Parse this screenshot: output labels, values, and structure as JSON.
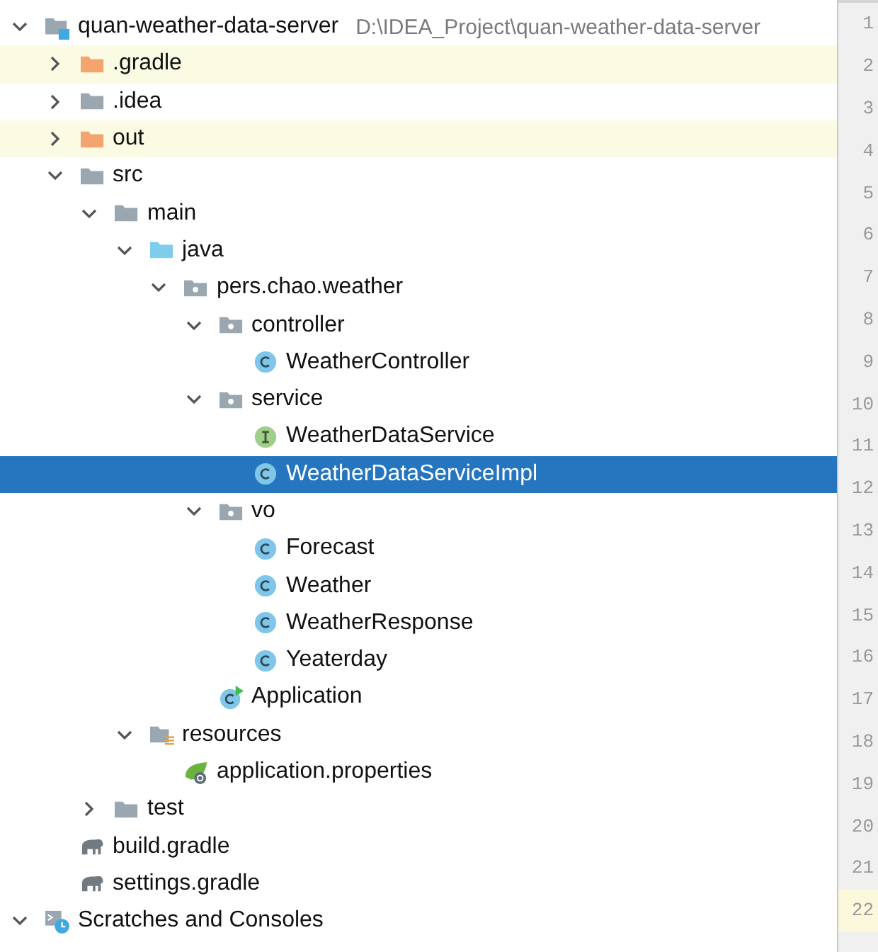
{
  "project_tree": [
    {
      "label": "quan-weather-data-server",
      "path": "D:\\IDEA_Project\\quan-weather-data-server",
      "kind": "module",
      "expanded": true,
      "selected": false,
      "children": [
        {
          "label": ".gradle",
          "kind": "folder",
          "excluded": true,
          "expanded": false,
          "selected": false
        },
        {
          "label": ".idea",
          "kind": "folder",
          "excluded": false,
          "expanded": false,
          "selected": false
        },
        {
          "label": "out",
          "kind": "folder",
          "excluded": true,
          "expanded": false,
          "selected": false
        },
        {
          "label": "src",
          "kind": "folder",
          "excluded": false,
          "expanded": true,
          "selected": false,
          "children": [
            {
              "label": "main",
              "kind": "folder",
              "excluded": false,
              "expanded": true,
              "selected": false,
              "children": [
                {
                  "label": "java",
                  "kind": "source-folder",
                  "expanded": true,
                  "selected": false,
                  "children": [
                    {
                      "label": "pers.chao.weather",
                      "kind": "package",
                      "expanded": true,
                      "selected": false,
                      "children": [
                        {
                          "label": "controller",
                          "kind": "package",
                          "expanded": true,
                          "selected": false,
                          "children": [
                            {
                              "label": "WeatherController",
                              "kind": "class",
                              "selected": false
                            }
                          ]
                        },
                        {
                          "label": "service",
                          "kind": "package",
                          "expanded": true,
                          "selected": false,
                          "children": [
                            {
                              "label": "WeatherDataService",
                              "kind": "interface",
                              "selected": false
                            },
                            {
                              "label": "WeatherDataServiceImpl",
                              "kind": "class",
                              "selected": true
                            }
                          ]
                        },
                        {
                          "label": "vo",
                          "kind": "package",
                          "expanded": true,
                          "selected": false,
                          "children": [
                            {
                              "label": "Forecast",
                              "kind": "class",
                              "selected": false
                            },
                            {
                              "label": "Weather",
                              "kind": "class",
                              "selected": false
                            },
                            {
                              "label": "WeatherResponse",
                              "kind": "class",
                              "selected": false
                            },
                            {
                              "label": "Yeaterday",
                              "kind": "class",
                              "selected": false
                            }
                          ]
                        },
                        {
                          "label": "Application",
                          "kind": "main-class",
                          "selected": false
                        }
                      ]
                    }
                  ]
                },
                {
                  "label": "resources",
                  "kind": "resources-folder",
                  "expanded": true,
                  "selected": false,
                  "children": [
                    {
                      "label": "application.properties",
                      "kind": "spring-config",
                      "selected": false
                    }
                  ]
                }
              ]
            },
            {
              "label": "test",
              "kind": "folder",
              "excluded": false,
              "expanded": false,
              "selected": false
            }
          ]
        },
        {
          "label": "build.gradle",
          "kind": "gradle",
          "selected": false
        },
        {
          "label": "settings.gradle",
          "kind": "gradle",
          "selected": false
        }
      ]
    },
    {
      "label": "Scratches and Consoles",
      "kind": "scratches",
      "expanded": true,
      "selected": false
    }
  ],
  "line_numbers": [
    {
      "number": "1",
      "current": false
    },
    {
      "number": "2",
      "current": false
    },
    {
      "number": "3",
      "current": false
    },
    {
      "number": "4",
      "current": false
    },
    {
      "number": "5",
      "current": false
    },
    {
      "number": "6",
      "current": false
    },
    {
      "number": "7",
      "current": false
    },
    {
      "number": "8",
      "current": false
    },
    {
      "number": "9",
      "current": false
    },
    {
      "number": "10",
      "current": false
    },
    {
      "number": "11",
      "current": false
    },
    {
      "number": "12",
      "current": false
    },
    {
      "number": "13",
      "current": false
    },
    {
      "number": "14",
      "current": false
    },
    {
      "number": "15",
      "current": false
    },
    {
      "number": "16",
      "current": false
    },
    {
      "number": "17",
      "current": false
    },
    {
      "number": "18",
      "current": false
    },
    {
      "number": "19",
      "current": false
    },
    {
      "number": "20",
      "current": false
    },
    {
      "number": "21",
      "current": false
    },
    {
      "number": "22",
      "current": true
    }
  ]
}
